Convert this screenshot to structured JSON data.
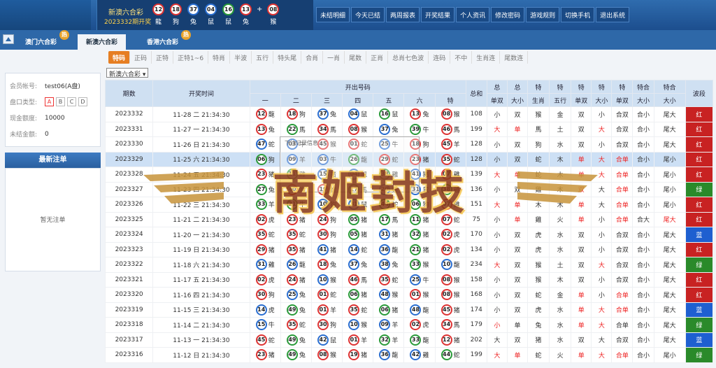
{
  "header": {
    "draw_title": "新澳六合彩",
    "draw_period": "2023332期开奖",
    "plus": "+",
    "balls": [
      {
        "num": "12",
        "zodiac": "龍",
        "color": "red"
      },
      {
        "num": "18",
        "zodiac": "狗",
        "color": "red"
      },
      {
        "num": "37",
        "zodiac": "兔",
        "color": "blue"
      },
      {
        "num": "04",
        "zodiac": "鼠",
        "color": "blue"
      },
      {
        "num": "16",
        "zodiac": "鼠",
        "color": "green"
      },
      {
        "num": "13",
        "zodiac": "兔",
        "color": "red"
      }
    ],
    "special_ball": {
      "num": "08",
      "zodiac": "猴",
      "color": "red"
    },
    "nav": [
      "未结明细",
      "今天已结",
      "两周报表",
      "开奖结果",
      "个人资讯",
      "修改密码",
      "游戏规则",
      "切换手机",
      "退出系统"
    ]
  },
  "game_tabs": [
    {
      "label": "澳门六合彩",
      "badge": "热",
      "active": false
    },
    {
      "label": "新澳六合彩",
      "badge": "",
      "active": true
    },
    {
      "label": "香港六合彩",
      "badge": "热",
      "active": false
    }
  ],
  "subtabs": [
    "特码",
    "正码",
    "正特",
    "正特1~6",
    "特肖",
    "半波",
    "五行",
    "特头尾",
    "合肖",
    "一肖",
    "尾数",
    "正肖",
    "总肖七色波",
    "连码",
    "不中",
    "生肖连",
    "尾数连"
  ],
  "account": {
    "rows": [
      {
        "key": "会员帐号:",
        "value": "test06(A盘)"
      },
      {
        "key": "盘口类型:",
        "value": ""
      },
      {
        "key": "现金额度:",
        "value": "10000"
      },
      {
        "key": "未结金额:",
        "value": "0"
      }
    ],
    "plates": [
      "A",
      "B",
      "C",
      "D"
    ],
    "active_plate": "A"
  },
  "latest_bets": {
    "title": "最新注单",
    "empty": "暂无注单"
  },
  "select_value": "新澳六合彩",
  "overlay": {
    "seal": "南姬封技",
    "popup_title": "下注记录信息"
  },
  "table": {
    "head_top": [
      "期数",
      "开奖时间",
      "开出号码",
      "总和",
      "总",
      "总",
      "特",
      "特",
      "特",
      "特",
      "特",
      "特合",
      "特合",
      "特合尾",
      "波段"
    ],
    "head_sub_nums": [
      "一",
      "二",
      "三",
      "四",
      "五",
      "六",
      "特"
    ],
    "head_sub_stats": [
      "单双",
      "大小",
      "生肖",
      "五行",
      "单双",
      "大小",
      "单双",
      "大小",
      "大小"
    ],
    "rows": [
      {
        "period": "2023332",
        "time": "11-28 二 21:34:30",
        "balls": [
          [
            "12",
            "龍",
            "r"
          ],
          [
            "18",
            "狗",
            "r"
          ],
          [
            "37",
            "兔",
            "b"
          ],
          [
            "04",
            "鼠",
            "b"
          ],
          [
            "16",
            "鼠",
            "g"
          ],
          [
            "13",
            "兔",
            "r"
          ],
          [
            "08",
            "猴",
            "r"
          ]
        ],
        "sum": "108",
        "s": [
          "小",
          "双",
          "猴",
          "金",
          "双",
          "小",
          "合双",
          "合小",
          "尾大"
        ],
        "red": [],
        "wave": "红",
        "wc": "r",
        "hl": false
      },
      {
        "period": "2023331",
        "time": "11-27 一 21:34:30",
        "balls": [
          [
            "13",
            "兔",
            "r"
          ],
          [
            "22",
            "馬",
            "g"
          ],
          [
            "34",
            "馬",
            "r"
          ],
          [
            "08",
            "猴",
            "r"
          ],
          [
            "37",
            "兔",
            "b"
          ],
          [
            "39",
            "牛",
            "g"
          ],
          [
            "46",
            "馬",
            "r"
          ]
        ],
        "sum": "199",
        "s": [
          "大",
          "单",
          "馬",
          "土",
          "双",
          "大",
          "合双",
          "合小",
          "尾大"
        ],
        "red": [
          0,
          1,
          5
        ],
        "wave": "红",
        "wc": "r",
        "hl": false
      },
      {
        "period": "2023330",
        "time": "11-26 日 21:34:30",
        "balls": [
          [
            "47",
            "蛇",
            "b"
          ],
          [
            "03",
            "牛",
            "b"
          ],
          [
            "45",
            "猴",
            "r"
          ],
          [
            "01",
            "蛇",
            "r"
          ],
          [
            "25",
            "牛",
            "b"
          ],
          [
            "18",
            "狗",
            "r"
          ],
          [
            "45",
            "羊",
            "r"
          ]
        ],
        "sum": "128",
        "s": [
          "小",
          "双",
          "狗",
          "水",
          "双",
          "小",
          "合双",
          "合小",
          "尾大"
        ],
        "red": [],
        "wave": "红",
        "wc": "r",
        "hl": false
      },
      {
        "period": "2023329",
        "time": "11-25 六 21:34:30",
        "balls": [
          [
            "06",
            "狗",
            "g"
          ],
          [
            "09",
            "羊",
            "b"
          ],
          [
            "03",
            "牛",
            "b"
          ],
          [
            "26",
            "龍",
            "g"
          ],
          [
            "29",
            "蛇",
            "r"
          ],
          [
            "23",
            "猪",
            "r"
          ],
          [
            "35",
            "蛇",
            "r"
          ]
        ],
        "sum": "128",
        "s": [
          "小",
          "双",
          "蛇",
          "木",
          "单",
          "大",
          "合单",
          "合小",
          "尾小"
        ],
        "red": [
          4,
          5,
          6
        ],
        "wave": "红",
        "wc": "r",
        "hl": true
      },
      {
        "period": "2023328",
        "time": "11-24 五 21:34:30",
        "balls": [
          [
            "23",
            "猪",
            "r"
          ],
          [
            "11",
            "雞",
            "g"
          ],
          [
            "15",
            "猪",
            "b"
          ],
          [
            "04",
            "鼠",
            "b"
          ],
          [
            "38",
            "雞",
            "g"
          ],
          [
            "41",
            "猪",
            "b"
          ],
          [
            "07",
            "雞",
            "r"
          ]
        ],
        "sum": "139",
        "s": [
          "大",
          "单",
          "蛇",
          "木",
          "单",
          "大",
          "合单",
          "合小",
          "尾小"
        ],
        "red": [
          0,
          1,
          4,
          5,
          6
        ],
        "wave": "红",
        "wc": "r",
        "hl": false
      },
      {
        "period": "2023327",
        "time": "11-23 四 21:34:30",
        "balls": [
          [
            "27",
            "兔",
            "g"
          ],
          [
            "40",
            "猴",
            "r"
          ],
          [
            "19",
            "猴",
            "r"
          ],
          [
            "17",
            "馬",
            "g"
          ],
          [
            "20",
            "雞",
            "b"
          ],
          [
            "31",
            "鼠",
            "b"
          ],
          [
            "38",
            "雞",
            "g"
          ]
        ],
        "sum": "136",
        "s": [
          "小",
          "双",
          "雞",
          "木",
          "双",
          "大",
          "合单",
          "合小",
          "尾小"
        ],
        "red": [
          4,
          6
        ],
        "wave": "绿",
        "wc": "g",
        "hl": false
      },
      {
        "period": "2023326",
        "time": "11-22 三 21:34:30",
        "balls": [
          [
            "33",
            "羊",
            "g"
          ],
          [
            "21",
            "牛",
            "g"
          ],
          [
            "10",
            "狗",
            "b"
          ],
          [
            "31",
            "鼠",
            "b"
          ],
          [
            "44",
            "蛇",
            "g"
          ],
          [
            "06",
            "狗",
            "g"
          ],
          [
            "07",
            "雞",
            "r"
          ]
        ],
        "sum": "151",
        "s": [
          "大",
          "单",
          "木",
          "木",
          "单",
          "大",
          "合单",
          "合小",
          "尾小"
        ],
        "red": [
          0,
          1,
          4,
          6
        ],
        "wave": "红",
        "wc": "r",
        "hl": false
      },
      {
        "period": "2023325",
        "time": "11-21 二 21:34:30",
        "balls": [
          [
            "02",
            "虎",
            "r"
          ],
          [
            "23",
            "猪",
            "r"
          ],
          [
            "24",
            "狗",
            "r"
          ],
          [
            "05",
            "猪",
            "g"
          ],
          [
            "17",
            "馬",
            "g"
          ],
          [
            "11",
            "猪",
            "g"
          ],
          [
            "07",
            "蛇",
            "r"
          ]
        ],
        "sum": "75",
        "s": [
          "小",
          "单",
          "雞",
          "火",
          "单",
          "小",
          "合单",
          "合大",
          "尾大"
        ],
        "red": [
          1,
          4,
          6,
          8
        ],
        "wave": "红",
        "wc": "r",
        "hl": false
      },
      {
        "period": "2023324",
        "time": "11-20 一 21:34:30",
        "balls": [
          [
            "35",
            "蛇",
            "r"
          ],
          [
            "35",
            "蛇",
            "r"
          ],
          [
            "30",
            "狗",
            "r"
          ],
          [
            "05",
            "猪",
            "g"
          ],
          [
            "31",
            "猪",
            "b"
          ],
          [
            "32",
            "猪",
            "g"
          ],
          [
            "02",
            "虎",
            "r"
          ]
        ],
        "sum": "170",
        "s": [
          "小",
          "双",
          "虎",
          "水",
          "双",
          "小",
          "合双",
          "合小",
          "尾大"
        ],
        "red": [],
        "wave": "蓝",
        "wc": "b",
        "hl": false
      },
      {
        "period": "2023323",
        "time": "11-19 日 21:34:30",
        "balls": [
          [
            "29",
            "猪",
            "r"
          ],
          [
            "35",
            "猪",
            "r"
          ],
          [
            "41",
            "猪",
            "b"
          ],
          [
            "14",
            "蛇",
            "b"
          ],
          [
            "36",
            "龍",
            "b"
          ],
          [
            "21",
            "猪",
            "g"
          ],
          [
            "02",
            "虎",
            "r"
          ]
        ],
        "sum": "134",
        "s": [
          "小",
          "双",
          "虎",
          "水",
          "双",
          "小",
          "合双",
          "合小",
          "尾大"
        ],
        "red": [],
        "wave": "红",
        "wc": "r",
        "hl": false
      },
      {
        "period": "2023322",
        "time": "11-18 六 21:34:30",
        "balls": [
          [
            "31",
            "雞",
            "b"
          ],
          [
            "26",
            "龍",
            "b"
          ],
          [
            "18",
            "兔",
            "r"
          ],
          [
            "37",
            "兔",
            "b"
          ],
          [
            "38",
            "兔",
            "b"
          ],
          [
            "33",
            "猴",
            "g"
          ],
          [
            "10",
            "龍",
            "b"
          ]
        ],
        "sum": "234",
        "s": [
          "大",
          "双",
          "猴",
          "土",
          "双",
          "大",
          "合双",
          "合小",
          "尾大"
        ],
        "red": [
          0,
          5
        ],
        "wave": "绿",
        "wc": "g",
        "hl": false
      },
      {
        "period": "2023321",
        "time": "11-17 五 21:34:30",
        "balls": [
          [
            "02",
            "虎",
            "r"
          ],
          [
            "24",
            "猪",
            "r"
          ],
          [
            "10",
            "猴",
            "b"
          ],
          [
            "46",
            "馬",
            "r"
          ],
          [
            "35",
            "蛇",
            "r"
          ],
          [
            "25",
            "牛",
            "b"
          ],
          [
            "08",
            "猴",
            "r"
          ]
        ],
        "sum": "158",
        "s": [
          "小",
          "双",
          "猴",
          "木",
          "双",
          "小",
          "合双",
          "合小",
          "尾大"
        ],
        "red": [],
        "wave": "红",
        "wc": "r",
        "hl": false
      },
      {
        "period": "2023320",
        "time": "11-16 四 21:34:30",
        "balls": [
          [
            "30",
            "狗",
            "r"
          ],
          [
            "25",
            "兔",
            "b"
          ],
          [
            "01",
            "蛇",
            "r"
          ],
          [
            "06",
            "猪",
            "g"
          ],
          [
            "48",
            "猴",
            "b"
          ],
          [
            "01",
            "猴",
            "r"
          ],
          [
            "08",
            "猴",
            "r"
          ]
        ],
        "sum": "168",
        "s": [
          "小",
          "双",
          "蛇",
          "金",
          "单",
          "小",
          "合单",
          "合小",
          "尾大"
        ],
        "red": [
          4,
          6
        ],
        "wave": "红",
        "wc": "r",
        "hl": false
      },
      {
        "period": "2023319",
        "time": "11-15 三 21:34:30",
        "balls": [
          [
            "14",
            "虎",
            "b"
          ],
          [
            "49",
            "兔",
            "g"
          ],
          [
            "01",
            "羊",
            "r"
          ],
          [
            "35",
            "蛇",
            "r"
          ],
          [
            "06",
            "猪",
            "g"
          ],
          [
            "48",
            "龍",
            "b"
          ],
          [
            "45",
            "猪",
            "r"
          ]
        ],
        "sum": "174",
        "s": [
          "小",
          "双",
          "虎",
          "水",
          "单",
          "大",
          "合单",
          "合小",
          "尾大"
        ],
        "red": [
          4,
          5,
          6
        ],
        "wave": "蓝",
        "wc": "b",
        "hl": false
      },
      {
        "period": "2023318",
        "time": "11-14 二 21:34:30",
        "balls": [
          [
            "15",
            "牛",
            "b"
          ],
          [
            "35",
            "蛇",
            "r"
          ],
          [
            "30",
            "狗",
            "r"
          ],
          [
            "10",
            "猴",
            "b"
          ],
          [
            "09",
            "羊",
            "b"
          ],
          [
            "02",
            "虎",
            "r"
          ],
          [
            "34",
            "馬",
            "r"
          ]
        ],
        "sum": "179",
        "s": [
          "小",
          "单",
          "兔",
          "水",
          "单",
          "大",
          "合单",
          "合小",
          "尾大"
        ],
        "red": [
          0,
          4,
          5
        ],
        "wave": "绿",
        "wc": "g",
        "hl": false
      },
      {
        "period": "2023317",
        "time": "11-13 一 21:34:30",
        "balls": [
          [
            "45",
            "蛇",
            "r"
          ],
          [
            "49",
            "兔",
            "g"
          ],
          [
            "42",
            "鼠",
            "b"
          ],
          [
            "01",
            "羊",
            "r"
          ],
          [
            "32",
            "羊",
            "g"
          ],
          [
            "33",
            "龍",
            "g"
          ],
          [
            "12",
            "猪",
            "r"
          ]
        ],
        "sum": "202",
        "s": [
          "大",
          "双",
          "猪",
          "水",
          "双",
          "大",
          "合双",
          "合小",
          "尾大"
        ],
        "red": [],
        "wave": "蓝",
        "wc": "b",
        "hl": false
      },
      {
        "period": "2023316",
        "time": "11-12 日 21:34:30",
        "balls": [
          [
            "23",
            "猪",
            "r"
          ],
          [
            "49",
            "兔",
            "g"
          ],
          [
            "08",
            "猴",
            "r"
          ],
          [
            "19",
            "猪",
            "r"
          ],
          [
            "36",
            "龍",
            "b"
          ],
          [
            "42",
            "雞",
            "b"
          ],
          [
            "44",
            "蛇",
            "g"
          ]
        ],
        "sum": "199",
        "s": [
          "大",
          "单",
          "蛇",
          "火",
          "单",
          "大",
          "合单",
          "合小",
          "尾小"
        ],
        "red": [
          0,
          1,
          4,
          5,
          6
        ],
        "wave": "绿",
        "wc": "g",
        "hl": false
      }
    ]
  }
}
